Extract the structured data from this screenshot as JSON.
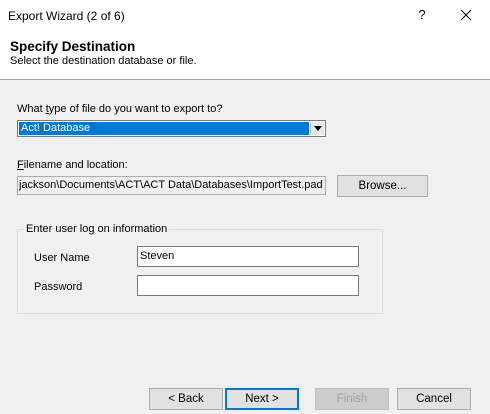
{
  "window": {
    "title": "Export Wizard (2 of 6)",
    "help_label": "?",
    "close_icon": "close-icon"
  },
  "header": {
    "title": "Specify Destination",
    "subtitle": "Select the destination database or file."
  },
  "file_type": {
    "label_pre": "What ",
    "label_accel": "t",
    "label_post": "ype of file do you want to export to?",
    "selected": "Act! Database"
  },
  "location": {
    "label_accel": "F",
    "label_post": "ilename and location:",
    "value": "jackson\\Documents\\ACT\\ACT Data\\Databases\\ImportTest.pad",
    "browse_label": "Browse..."
  },
  "logon": {
    "legend": "Enter user log on information",
    "username_label": "User Name",
    "username_value": "Steven",
    "password_label": "Password",
    "password_value": ""
  },
  "footer": {
    "back_label": "< Back",
    "next_label": "Next >",
    "finish_label": "Finish",
    "cancel_label": "Cancel"
  }
}
